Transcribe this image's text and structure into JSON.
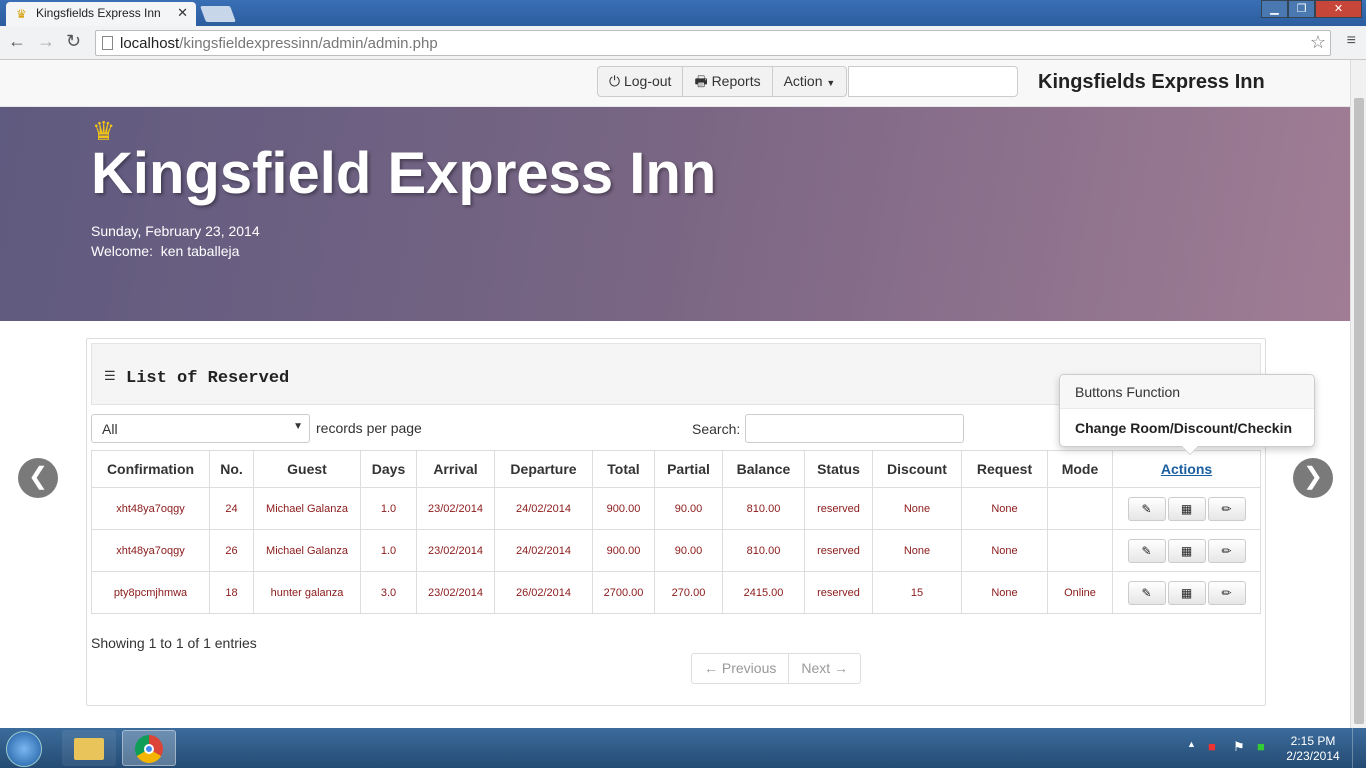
{
  "browser": {
    "tab_title": "Kingsfields Express Inn",
    "close_glyph": "✕",
    "url_host": "localhost",
    "url_path": "/kingsfieldexpressinn/admin/admin.php"
  },
  "navbar": {
    "logout_label": "Log-out",
    "reports_label": "Reports",
    "action_label": "Action",
    "search_value": "",
    "brand": "Kingsfields Express Inn"
  },
  "hero": {
    "title": "Kingsfield Express Inn",
    "date": "Sunday, February 23, 2014",
    "welcome": "Welcome:  ken taballeja"
  },
  "panel": {
    "title": "List of Reserved",
    "filter_value": "All",
    "records_per_page": "records per page",
    "search_label": "Search:",
    "search_value": "",
    "columns": [
      "Confirmation",
      "No.",
      "Guest",
      "Days",
      "Arrival",
      "Departure",
      "Total",
      "Partial",
      "Balance",
      "Status",
      "Discount",
      "Request",
      "Mode",
      "Actions"
    ],
    "rows": [
      [
        "xht48ya7oqgy",
        "24",
        "Michael Galanza",
        "1.0",
        "23/02/2014",
        "24/02/2014",
        "900.00",
        "90.00",
        "810.00",
        "reserved",
        "None",
        "None",
        ""
      ],
      [
        "xht48ya7oqgy",
        "26",
        "Michael Galanza",
        "1.0",
        "23/02/2014",
        "24/02/2014",
        "900.00",
        "90.00",
        "810.00",
        "reserved",
        "None",
        "None",
        ""
      ],
      [
        "pty8pcmjhmwa",
        "18",
        "hunter galanza",
        "3.0",
        "23/02/2014",
        "26/02/2014",
        "2700.00",
        "270.00",
        "2415.00",
        "reserved",
        "15",
        "None",
        "Online"
      ]
    ],
    "showing": "Showing 1 to 1 of 1 entries",
    "prev_label": "← Previous",
    "next_label": "Next →"
  },
  "popover": {
    "title": "Buttons Function",
    "content": "Change Room/Discount/Checkin"
  },
  "taskbar": {
    "time": "2:15 PM",
    "date": "2/23/2014"
  },
  "icons": {
    "edit": "edit-icon",
    "gift": "gift-icon",
    "pencil": "pencil-icon",
    "power": "power-icon",
    "print": "print-icon",
    "list": "list-icon",
    "crown": "crown-icon"
  },
  "colors": {
    "hero_start": "#5f5a7f",
    "hero_end": "#a07d95",
    "cell_text": "#8b1a1a",
    "actions_link": "#1a5fa0"
  }
}
